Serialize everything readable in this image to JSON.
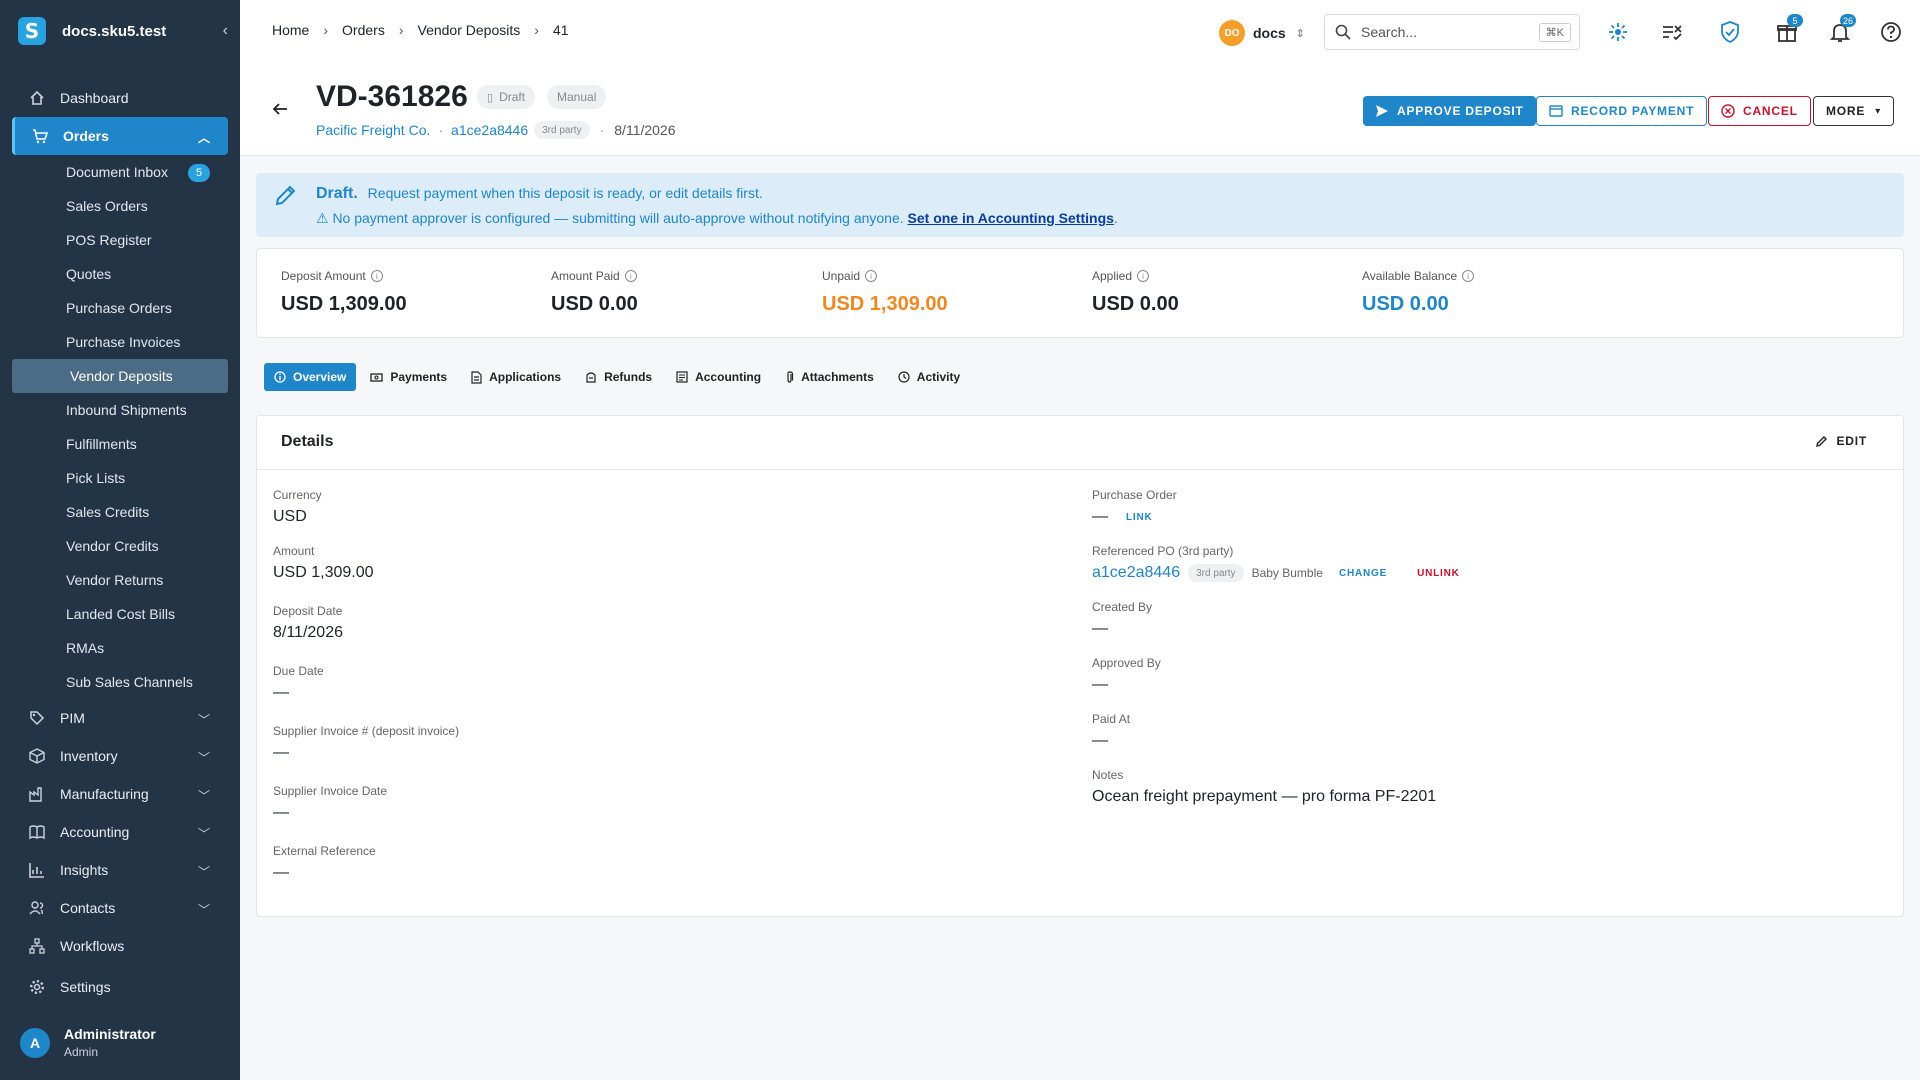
{
  "brand": {
    "name": "docs.sku5.test",
    "logo_letter": "S"
  },
  "sidebar": {
    "top": [
      {
        "label": "Dashboard",
        "icon": "home-icon"
      }
    ],
    "orders": {
      "label": "Orders",
      "icon": "cart-icon"
    },
    "orders_items": [
      {
        "label": "Document Inbox",
        "badge": "5"
      },
      {
        "label": "Sales Orders"
      },
      {
        "label": "POS Register"
      },
      {
        "label": "Quotes"
      },
      {
        "label": "Purchase Orders"
      },
      {
        "label": "Purchase Invoices"
      },
      {
        "label": "Vendor Deposits"
      },
      {
        "label": "Inbound Shipments"
      },
      {
        "label": "Fulfillments"
      },
      {
        "label": "Pick Lists"
      },
      {
        "label": "Sales Credits"
      },
      {
        "label": "Vendor Credits"
      },
      {
        "label": "Vendor Returns"
      },
      {
        "label": "Landed Cost Bills"
      },
      {
        "label": "RMAs"
      },
      {
        "label": "Sub Sales Channels"
      }
    ],
    "sections": [
      {
        "label": "PIM",
        "icon": "tag-icon"
      },
      {
        "label": "Inventory",
        "icon": "box-icon"
      },
      {
        "label": "Manufacturing",
        "icon": "factory-icon"
      },
      {
        "label": "Accounting",
        "icon": "book-icon"
      },
      {
        "label": "Insights",
        "icon": "chart-icon"
      },
      {
        "label": "Contacts",
        "icon": "contacts-icon"
      },
      {
        "label": "Workflows",
        "icon": "workflow-icon"
      }
    ],
    "settings": {
      "label": "Settings",
      "icon": "gear-icon"
    },
    "user": {
      "initial": "A",
      "name": "Administrator",
      "role": "Admin"
    }
  },
  "topbar": {
    "breadcrumbs": [
      "Home",
      "Orders",
      "Vendor Deposits",
      "41"
    ],
    "org": {
      "initials": "DO",
      "name": "docs"
    },
    "search": {
      "placeholder": "Search...",
      "shortcut": "⌘K"
    },
    "gifts_badge": "5",
    "notifications_badge": "26"
  },
  "header": {
    "title": "VD-361826",
    "status": "Draft",
    "source": "Manual",
    "vendor": "Pacific Freight Co.",
    "po_ref": "a1ce2a8446",
    "po_ref_tag": "3rd party",
    "date": "8/11/2026",
    "buttons": {
      "approve": "APPROVE DEPOSIT",
      "record": "RECORD PAYMENT",
      "cancel": "CANCEL",
      "more": "MORE"
    }
  },
  "banner": {
    "title": "Draft.",
    "message": "Request payment when this deposit is ready, or edit details first.",
    "warning": "⚠ No payment approver is configured — submitting will auto-approve without notifying anyone.",
    "link": "Set one in Accounting Settings",
    "end": "."
  },
  "stats": [
    {
      "label": "Deposit Amount",
      "value": "USD 1,309.00",
      "color": "#1f2328"
    },
    {
      "label": "Amount Paid",
      "value": "USD 0.00",
      "color": "#1f2328"
    },
    {
      "label": "Unpaid",
      "value": "USD 1,309.00",
      "color": "#f0871f"
    },
    {
      "label": "Applied",
      "value": "USD 0.00",
      "color": "#1f2328"
    },
    {
      "label": "Available Balance",
      "value": "USD 0.00",
      "color": "#1f86c9"
    }
  ],
  "tabs": [
    "Overview",
    "Payments",
    "Applications",
    "Refunds",
    "Accounting",
    "Attachments",
    "Activity"
  ],
  "details": {
    "title": "Details",
    "edit": "EDIT",
    "left": [
      {
        "label": "Currency",
        "value": "USD"
      },
      {
        "label": "Amount",
        "value": "USD 1,309.00"
      },
      {
        "label": "Deposit Date",
        "value": "8/11/2026"
      },
      {
        "label": "Due Date",
        "value": "—"
      },
      {
        "label": "Supplier Invoice # (deposit invoice)",
        "value": "—"
      },
      {
        "label": "Supplier Invoice Date",
        "value": "—"
      },
      {
        "label": "External Reference",
        "value": "—"
      }
    ],
    "purchase_order": {
      "label": "Purchase Order",
      "value": "—",
      "action": "LINK"
    },
    "referenced_po": {
      "label": "Referenced PO (3rd party)",
      "value": "a1ce2a8446",
      "tag": "3rd party",
      "vendor": "Baby Bumble",
      "change": "CHANGE",
      "unlink": "UNLINK"
    },
    "right": [
      {
        "label": "Created By",
        "value": "—"
      },
      {
        "label": "Approved By",
        "value": "—"
      },
      {
        "label": "Paid At",
        "value": "—"
      },
      {
        "label": "Notes",
        "value": "Ocean freight prepayment — pro forma PF-2201"
      }
    ]
  },
  "colors": {
    "accent": "#1f86c9",
    "danger": "#c8102e",
    "warning": "#f0871f",
    "sidebar": "#243447"
  }
}
